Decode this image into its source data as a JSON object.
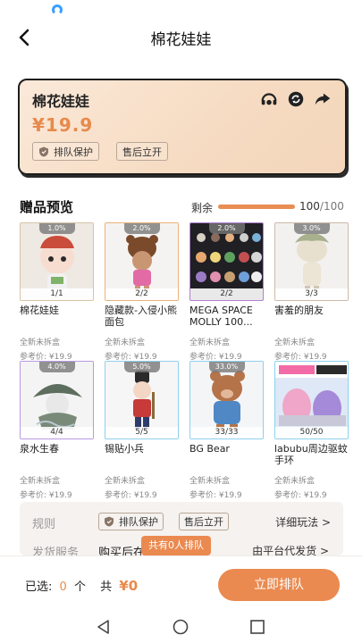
{
  "nav": {
    "title": "棉花娃娃"
  },
  "hero": {
    "title": "棉花娃娃",
    "price": "¥19.9",
    "tags": [
      "排队保护",
      "售后立开"
    ],
    "icons": [
      "customer-service-icon",
      "refresh-icon",
      "share-icon"
    ]
  },
  "gifts": {
    "title": "赠品预览",
    "remain_label": "剩余",
    "remain_current": "100",
    "remain_total": "/100",
    "remain_fraction": 1.0,
    "items": [
      {
        "name": "棉花娃娃",
        "prob": "1.0%",
        "qty": "1/1",
        "cond": "全新未拆盒",
        "price": "参考价: ¥19.9",
        "border": "#d8c3a6"
      },
      {
        "name": "隐藏款-入侵小熊面包",
        "prob": "2.0%",
        "qty": "2/2",
        "cond": "全新未拆盒",
        "price": "参考价: ¥19.9",
        "border": "#eab27b"
      },
      {
        "name": "MEGA SPACE MOLLY 100...",
        "prob": "2.0%",
        "qty": "2/2",
        "cond": "全新未拆盒",
        "price": "参考价: ¥19.9",
        "border": "#b27fd6"
      },
      {
        "name": "害羞的朋友",
        "prob": "3.0%",
        "qty": "3/3",
        "cond": "全新未拆盒",
        "price": "参考价: ¥19.9",
        "border": "#cfb9a7"
      },
      {
        "name": "泉水生春",
        "prob": "4.0%",
        "qty": "4/4",
        "cond": "全新未拆盒",
        "price": "参考价: ¥19.9",
        "border": "#b79ae2"
      },
      {
        "name": "锡贴小兵",
        "prob": "5.0%",
        "qty": "5/5",
        "cond": "全新未拆盒",
        "price": "参考价: ¥19.9",
        "border": "#8fd0ef"
      },
      {
        "name": "BG Bear",
        "prob": "33.0%",
        "qty": "33/33",
        "cond": "全新未拆盒",
        "price": "参考价: ¥19.9",
        "border": "#8fd0ef"
      },
      {
        "name": "labubu周边驱蚊手环",
        "prob": "",
        "qty": "50/50",
        "cond": "全新未拆盒",
        "price": "参考价: ¥19.9",
        "border": "#8fd0ef"
      }
    ]
  },
  "rules": {
    "label": "规则",
    "tags": [
      "排队保护",
      "售后立开"
    ],
    "link": "详细玩法 >",
    "ship_label": "发货服务",
    "ship_main": "购买后在",
    "ship_link": "由平台代发货 >"
  },
  "queue_pill": "共有0人排队",
  "footer": {
    "selected_label": "已选:",
    "selected_count": "0",
    "selected_unit": "个",
    "total_label": "共",
    "total_amount": "¥0",
    "queue_button": "立即排队"
  },
  "colors": {
    "accent": "#ea8a50",
    "price": "#e78a4c"
  }
}
